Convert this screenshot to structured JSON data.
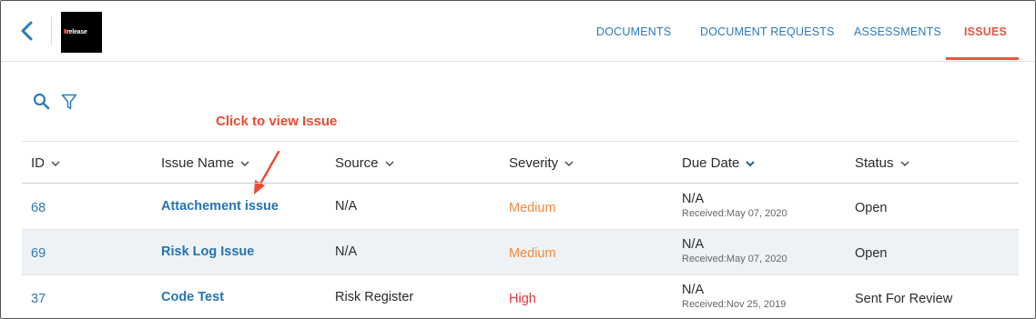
{
  "app": {
    "logo_text": "release",
    "brand_accent": "#e8553e",
    "link_color": "#2a7bb6"
  },
  "header": {
    "back_icon": "chevron-left-icon",
    "tabs": [
      {
        "label": "DOCUMENTS",
        "active": false
      },
      {
        "label": "DOCUMENT REQUESTS",
        "active": false
      },
      {
        "label": "ASSESSMENTS",
        "active": false
      },
      {
        "label": "ISSUES",
        "active": true
      }
    ]
  },
  "toolbar": {
    "search_icon": "search-icon",
    "filter_icon": "filter-icon"
  },
  "annotation": {
    "text": "Click to view Issue",
    "color": "#ee4a2f"
  },
  "table": {
    "columns": [
      {
        "label": "ID"
      },
      {
        "label": "Issue Name"
      },
      {
        "label": "Source"
      },
      {
        "label": "Severity"
      },
      {
        "label": "Due Date",
        "sorted": true
      },
      {
        "label": "Status"
      }
    ],
    "rows": [
      {
        "id": "68",
        "name": "Attachement issue",
        "source": "N/A",
        "severity": "Medium",
        "due": "N/A",
        "received": "Received:May 07, 2020",
        "status": "Open"
      },
      {
        "id": "69",
        "name": "Risk Log Issue",
        "source": "N/A",
        "severity": "Medium",
        "due": "N/A",
        "received": "Received:May 07, 2020",
        "status": "Open"
      },
      {
        "id": "37",
        "name": "Code Test",
        "source": "Risk Register",
        "severity": "High",
        "due": "N/A",
        "received": "Received:Nov 25, 2019",
        "status": "Sent For Review"
      }
    ]
  }
}
